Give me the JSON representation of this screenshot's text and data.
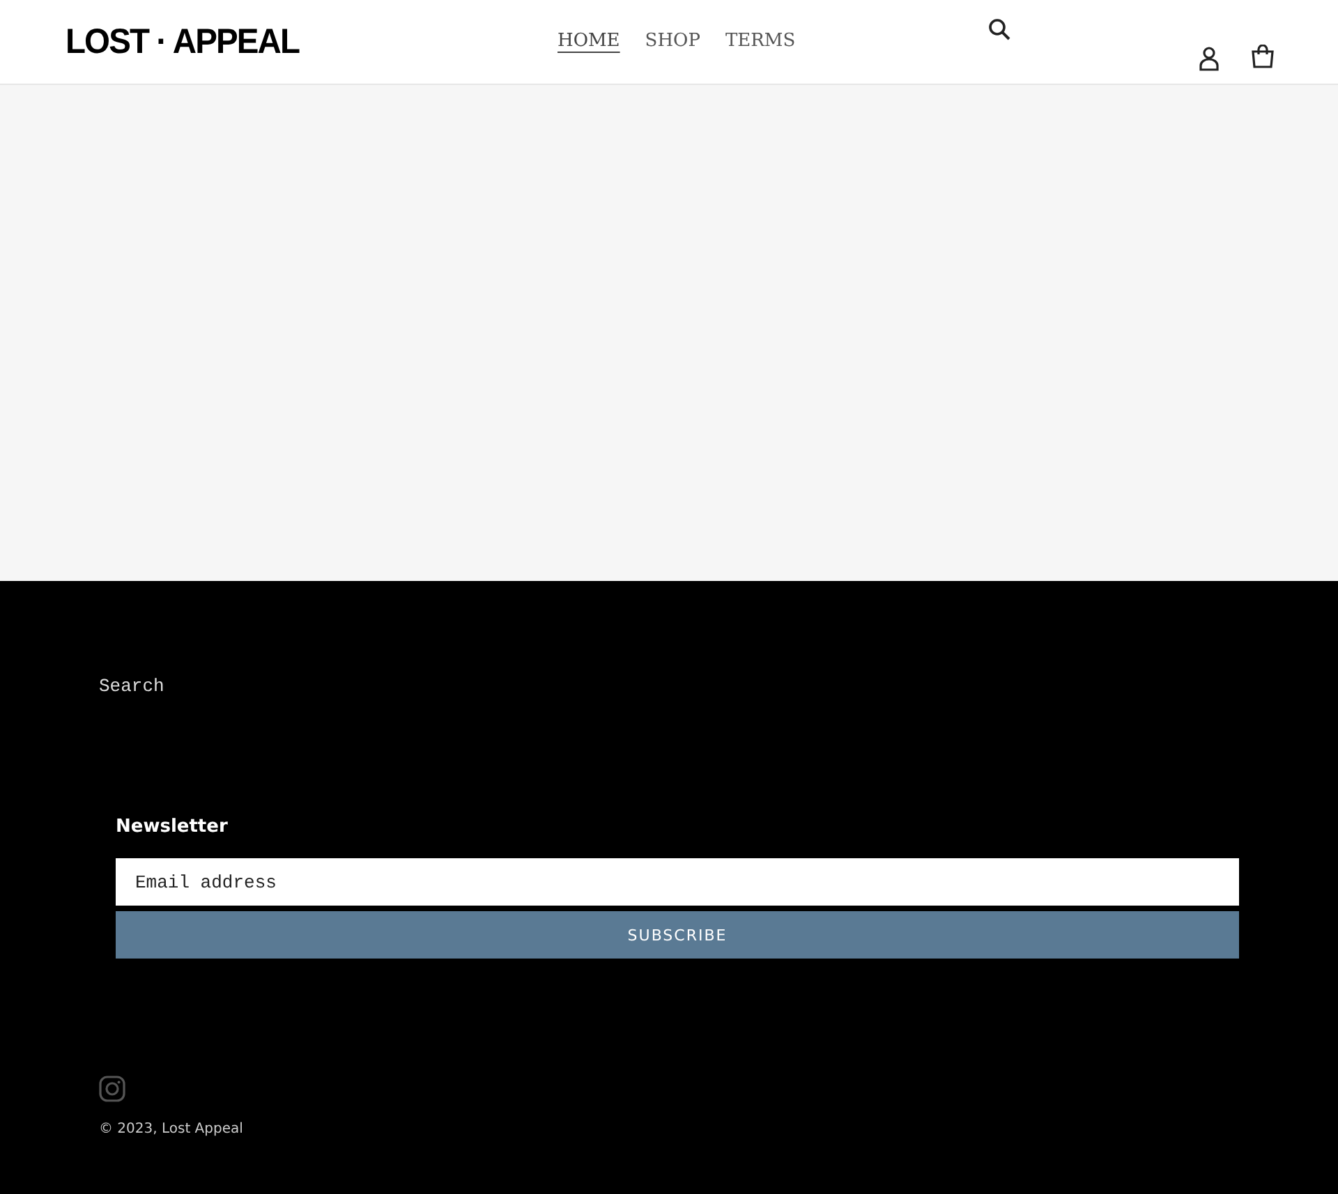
{
  "header": {
    "logo": "LOST · APPEAL",
    "nav": [
      {
        "label": "HOME",
        "selected": true
      },
      {
        "label": "SHOP",
        "selected": false
      },
      {
        "label": "TERMS",
        "selected": false
      }
    ]
  },
  "footer": {
    "links": [
      "Search"
    ],
    "newsletter": {
      "title": "Newsletter",
      "placeholder": "Email address",
      "button": "SUBSCRIBE"
    },
    "copyright": "© 2023, Lost Appeal"
  }
}
